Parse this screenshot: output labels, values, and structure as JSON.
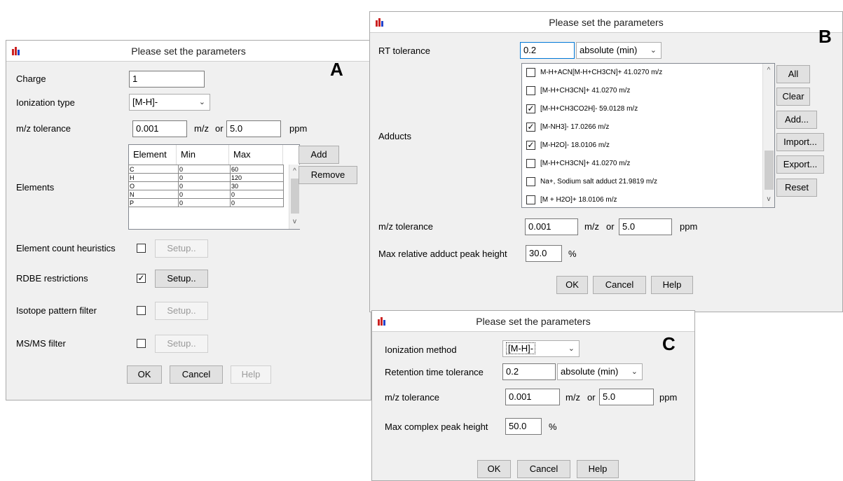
{
  "panel_a": {
    "title": "Please set the parameters",
    "letter": "A",
    "charge_label": "Charge",
    "charge_value": "1",
    "ionization_label": "Ionization type",
    "ionization_value": "[M-H]-",
    "mz_label": "m/z tolerance",
    "mz_value": "0.001",
    "mz_unit": "m/z",
    "or_label": "or",
    "ppm_value": "5.0",
    "ppm_unit": "ppm",
    "elements_label": "Elements",
    "columns": [
      "Element",
      "Min",
      "Max"
    ],
    "rows": [
      [
        "C",
        "0",
        "60"
      ],
      [
        "H",
        "0",
        "120"
      ],
      [
        "O",
        "0",
        "30"
      ],
      [
        "N",
        "0",
        "0"
      ],
      [
        "P",
        "0",
        "0"
      ]
    ],
    "add_label": "Add",
    "remove_label": "Remove",
    "heuristics_label": "Element count heuristics",
    "rdbe_label": "RDBE restrictions",
    "isotope_label": "Isotope pattern filter",
    "msms_label": "MS/MS filter",
    "setup_label": "Setup..",
    "checked_mark": "✓",
    "ok_label": "OK",
    "cancel_label": "Cancel",
    "help_label": "Help"
  },
  "panel_b": {
    "title": "Please set the parameters",
    "letter": "B",
    "rt_label": "RT tolerance",
    "rt_value": "0.2",
    "rt_unit": "absolute (min)",
    "adducts_label": "Adducts",
    "adducts": [
      {
        "text": "M-H+ACN[M-H+CH3CN]+  41.0270 m/z",
        "checked": ""
      },
      {
        "text": "[M-H+CH3CN]+  41.0270 m/z",
        "checked": ""
      },
      {
        "text": "[M-H+CH3CO2H]- 59.0128 m/z",
        "checked": "✓"
      },
      {
        "text": "[M-NH3]- 17.0266 m/z",
        "checked": "✓"
      },
      {
        "text": "[M-H2O]- 18.0106 m/z",
        "checked": "✓"
      },
      {
        "text": "[M-H+CH3CN]+ 41.0270 m/z",
        "checked": ""
      },
      {
        "text": "Na+, Sodium salt adduct  21.9819 m/z",
        "checked": ""
      },
      {
        "text": "[M + H2O]+  18.0106 m/z",
        "checked": ""
      }
    ],
    "all_label": "All",
    "clear_label": "Clear",
    "add_label": "Add...",
    "import_label": "Import...",
    "export_label": "Export...",
    "reset_label": "Reset",
    "mz_label": "m/z tolerance",
    "mz_value": "0.001",
    "mz_unit": "m/z",
    "or_label": "or",
    "ppm_value": "5.0",
    "ppm_unit": "ppm",
    "max_label": "Max relative adduct peak height",
    "max_value": "30.0",
    "percent": "%",
    "ok_label": "OK",
    "cancel_label": "Cancel",
    "help_label": "Help"
  },
  "panel_c": {
    "title": "Please set the parameters",
    "letter": "C",
    "ion_label": "Ionization method",
    "ion_value": "[M-H]-",
    "rt_label": "Retention time tolerance",
    "rt_value": "0.2",
    "rt_unit": "absolute (min)",
    "mz_label": "m/z tolerance",
    "mz_value": "0.001",
    "mz_unit": "m/z",
    "or_label": "or",
    "ppm_value": "5.0",
    "ppm_unit": "ppm",
    "max_label": "Max complex peak height",
    "max_value": "50.0",
    "percent": "%",
    "ok_label": "OK",
    "cancel_label": "Cancel",
    "help_label": "Help"
  },
  "colors": {
    "icon_red": "#cc2222",
    "icon_blue": "#2244cc",
    "title_bg": "#ffffff",
    "dialog_bg": "#f0f0f0"
  }
}
